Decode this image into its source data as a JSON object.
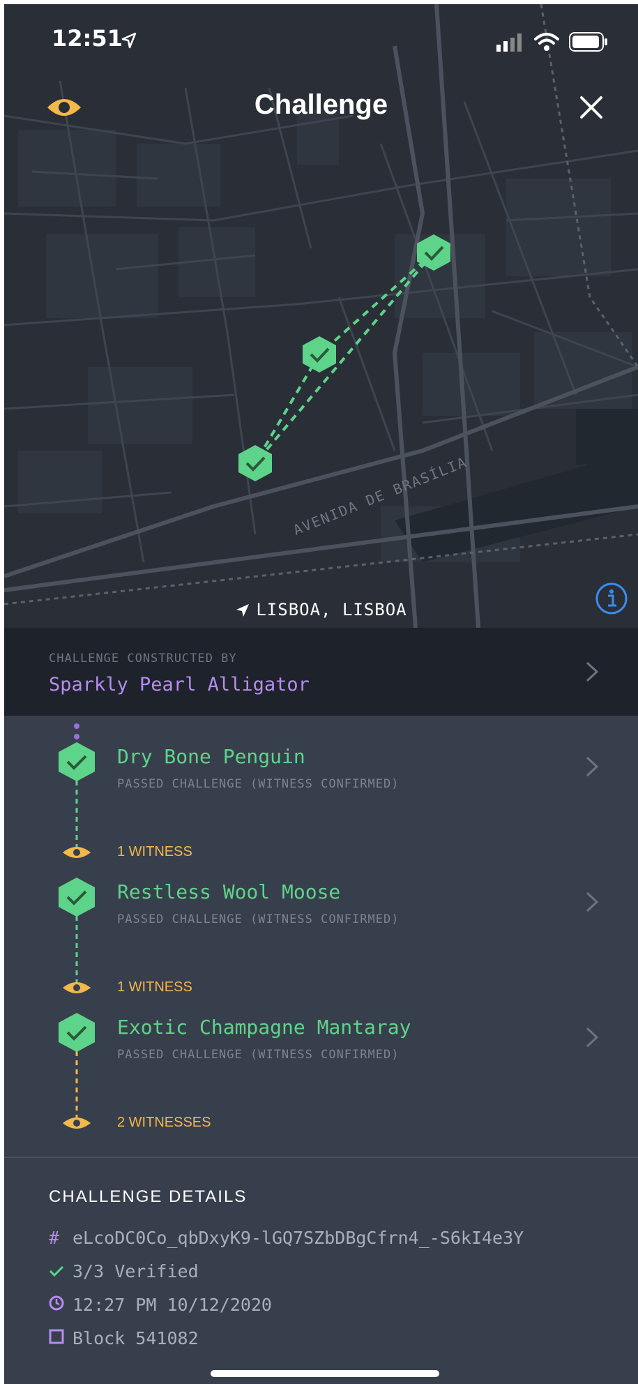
{
  "status_bar": {
    "time": "12:51"
  },
  "header": {
    "title": "Challenge"
  },
  "map": {
    "street_label": "AVENIDA DE BRASÍLIA",
    "location": "LISBOA, LISBOA"
  },
  "constructor": {
    "label": "CHALLENGE CONSTRUCTED BY",
    "name": "Sparkly Pearl Alligator"
  },
  "witnesses": [
    {
      "name": "Dry Bone Penguin",
      "status": "PASSED CHALLENGE (WITNESS CONFIRMED)",
      "count": "1 WITNESS"
    },
    {
      "name": "Restless Wool Moose",
      "status": "PASSED CHALLENGE (WITNESS CONFIRMED)",
      "count": "1 WITNESS"
    },
    {
      "name": "Exotic Champagne Mantaray",
      "status": "PASSED CHALLENGE (WITNESS CONFIRMED)",
      "count": "2 WITNESSES"
    }
  ],
  "details": {
    "title": "CHALLENGE DETAILS",
    "hash": "eLcoDC0Co_qbDxyK9-lGQ7SZbDBgCfrn4_-S6kI4e3Y",
    "verified": "3/3 Verified",
    "timestamp": "12:27 PM 10/12/2020",
    "block": "Block 541082"
  },
  "colors": {
    "accent_green": "#5ed38a",
    "accent_purple": "#b58cf0",
    "accent_yellow": "#f2b84a",
    "info_blue": "#3b8bf0"
  },
  "icons": [
    "location-arrow-icon",
    "signal-icon",
    "wifi-icon",
    "battery-icon",
    "eye-icon",
    "close-icon",
    "info-icon",
    "chevron-right-icon",
    "hexagon-check-icon",
    "hash-icon",
    "check-icon",
    "clock-icon",
    "block-icon"
  ]
}
